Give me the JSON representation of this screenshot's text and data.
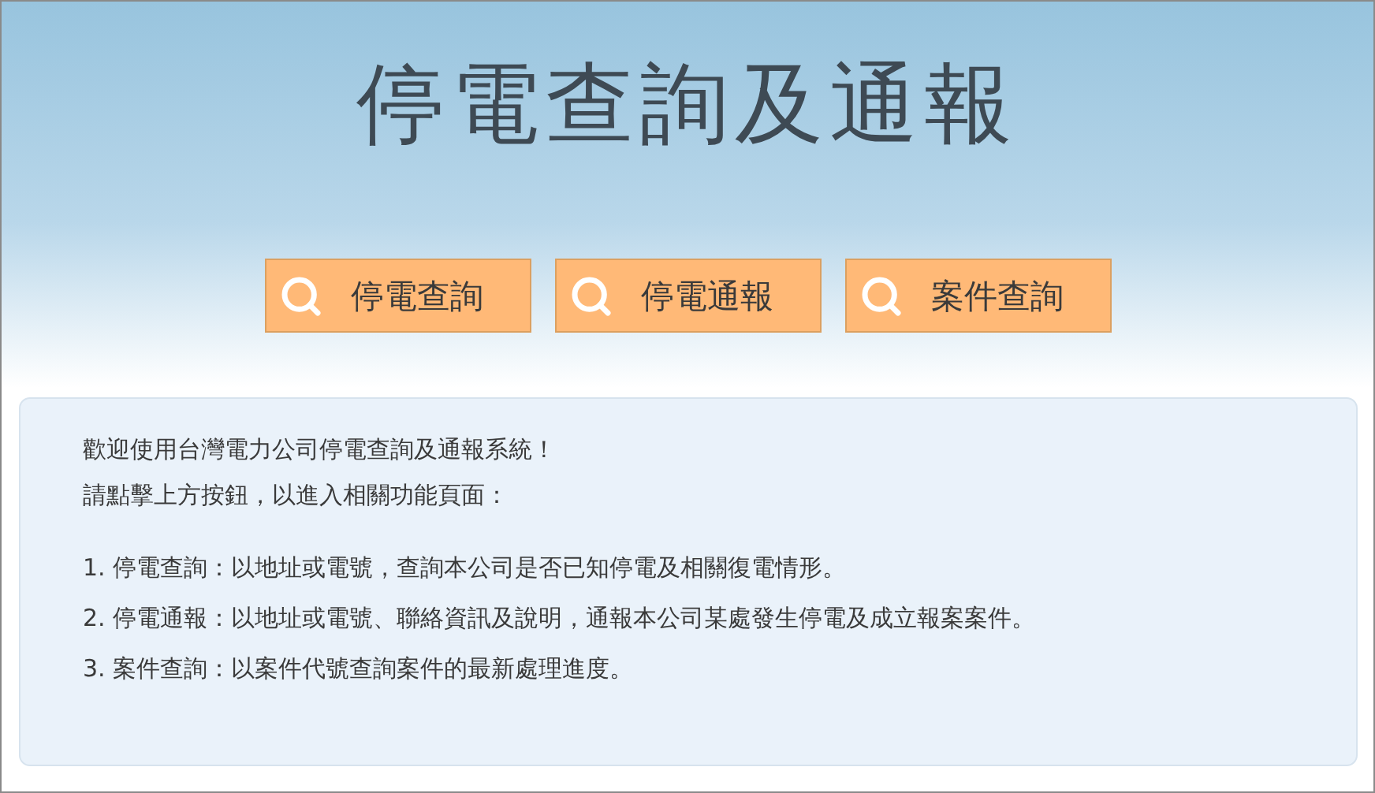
{
  "title": "停電查詢及通報",
  "buttons": [
    {
      "label": "停電查詢"
    },
    {
      "label": "停電通報"
    },
    {
      "label": "案件查詢"
    }
  ],
  "intro": [
    "歡迎使用台灣電力公司停電查詢及通報系統！",
    "請點擊上方按鈕，以進入相關功能頁面："
  ],
  "items": [
    "1. 停電查詢：以地址或電號，查詢本公司是否已知停電及相關復電情形。",
    "2. 停電通報：以地址或電號、聯絡資訊及說明，通報本公司某處發生停電及成立報案案件。",
    "3. 案件查詢：以案件代號查詢案件的最新處理進度。"
  ]
}
